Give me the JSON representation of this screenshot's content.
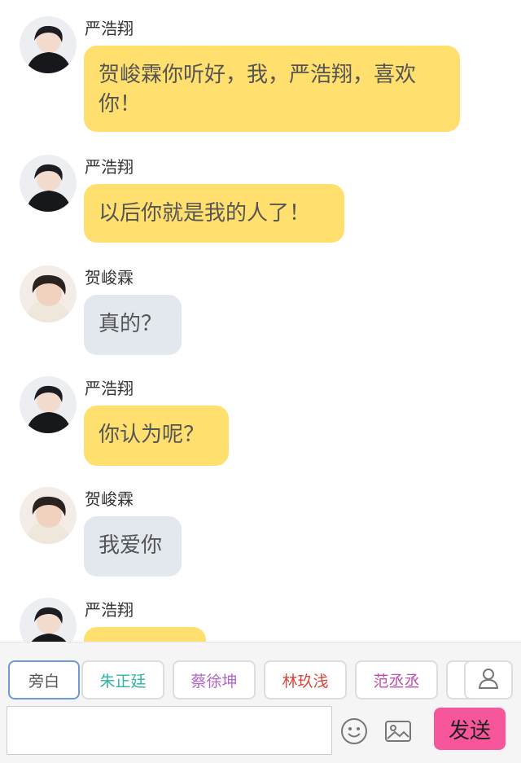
{
  "messages": [
    {
      "speaker": "严浩翔",
      "text": "贺峻霖你听好，我，严浩翔，喜欢你！",
      "bubble_color": "#ffdf6e"
    },
    {
      "speaker": "严浩翔",
      "text": "以后你就是我的人了！",
      "bubble_color": "#ffdf6e"
    },
    {
      "speaker": "贺峻霖",
      "text": "真的？",
      "bubble_color": "#e3e8ef"
    },
    {
      "speaker": "严浩翔",
      "text": "你认为呢？",
      "bubble_color": "#ffdf6e"
    },
    {
      "speaker": "贺峻霖",
      "text": "我爱你",
      "bubble_color": "#e3e8ef"
    },
    {
      "speaker": "严浩翔",
      "text": "",
      "bubble_color": "#ffdf6e"
    }
  ],
  "roles": [
    {
      "label": "旁白",
      "color": "#555555",
      "selected": true
    },
    {
      "label": "朱正廷",
      "color": "#2db3a3",
      "selected": false
    },
    {
      "label": "蔡徐坤",
      "color": "#b266c9",
      "selected": false
    },
    {
      "label": "林玖浅",
      "color": "#d9473b",
      "selected": false
    },
    {
      "label": "范丞丞",
      "color": "#c24fa8",
      "selected": false
    }
  ],
  "composer": {
    "placeholder": "",
    "send_label": "发送",
    "icons": [
      "person-icon",
      "emoji-icon",
      "image-icon"
    ]
  }
}
